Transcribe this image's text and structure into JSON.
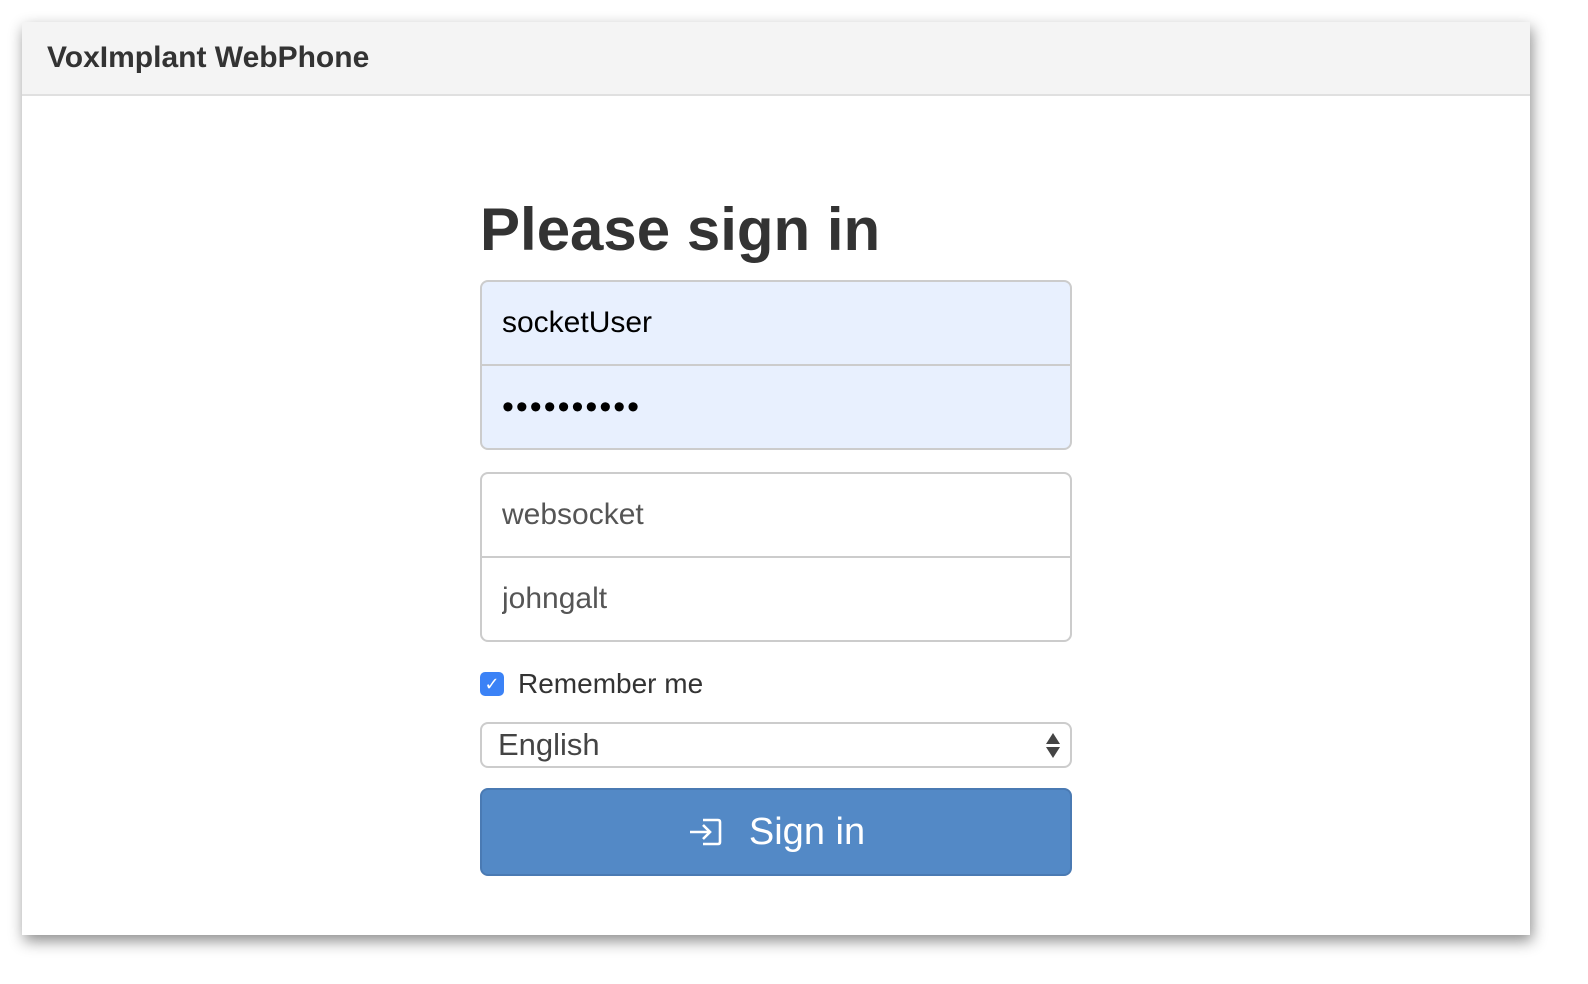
{
  "navbar": {
    "brand": "VoxImplant WebPhone"
  },
  "form": {
    "heading": "Please sign in",
    "username": {
      "value": "socketUser"
    },
    "password": {
      "value": "••••••••••"
    },
    "app_name": {
      "value": "websocket"
    },
    "account_name": {
      "value": "johngalt"
    },
    "remember_me": {
      "label": "Remember me",
      "checked": true,
      "check_glyph": "✓"
    },
    "language": {
      "selected": "English"
    },
    "submit": {
      "label": "Sign in",
      "icon": "sign-in-icon"
    }
  },
  "colors": {
    "navbar_bg": "#f4f4f4",
    "autofill_bg": "#e8f0fe",
    "button_bg": "#5389c6",
    "checkbox_bg": "#3b82f6"
  }
}
